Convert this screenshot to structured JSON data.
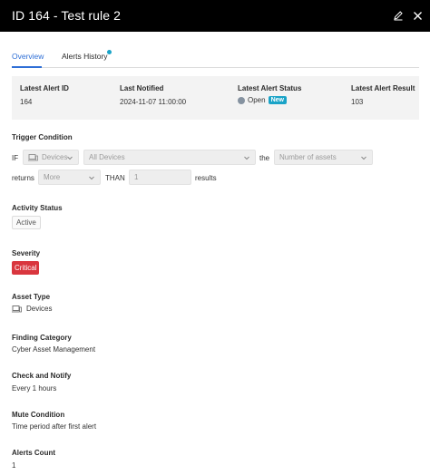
{
  "header": {
    "title": "ID 164 - Test rule 2"
  },
  "tabs": [
    {
      "label": "Overview",
      "active": true
    },
    {
      "label": "Alerts History",
      "active": false,
      "has_dot": true
    }
  ],
  "summary": {
    "latest_alert_id": {
      "label": "Latest Alert ID",
      "value": "164"
    },
    "last_notified": {
      "label": "Last Notified",
      "value": "2024-11-07 11:00:00"
    },
    "latest_alert_status": {
      "label": "Latest Alert Status",
      "value": "Open",
      "badge": "New"
    },
    "latest_alert_result": {
      "label": "Latest Alert Result",
      "value": "103"
    }
  },
  "trigger": {
    "label": "Trigger Condition",
    "if_text": "IF",
    "entity_select": "Devices",
    "scope_select": "All Devices",
    "the_text": "the",
    "metric_placeholder": "Number of assets",
    "returns_text": "returns",
    "comparator_select": "More",
    "than_text": "THAN",
    "threshold_placeholder": "1",
    "results_text": "results"
  },
  "activity_status": {
    "label": "Activity Status",
    "value": "Active"
  },
  "severity": {
    "label": "Severity",
    "value": "Critical"
  },
  "asset_type": {
    "label": "Asset Type",
    "value": "Devices"
  },
  "finding_category": {
    "label": "Finding Category",
    "value": "Cyber Asset Management"
  },
  "check_and_notify": {
    "label": "Check and Notify",
    "value": "Every 1 hours"
  },
  "mute_condition": {
    "label": "Mute Condition",
    "value": "Time period after first alert"
  },
  "alerts_count": {
    "label": "Alerts Count",
    "value": "1"
  },
  "colors": {
    "header_bg": "#000000",
    "accent": "#2f6fd6",
    "new_badge": "#1aa3c7",
    "critical": "#d9363e"
  },
  "icons": {
    "edit": "pencil-icon",
    "close": "close-icon",
    "device": "device-icon",
    "chevron": "chevron-down-icon"
  }
}
